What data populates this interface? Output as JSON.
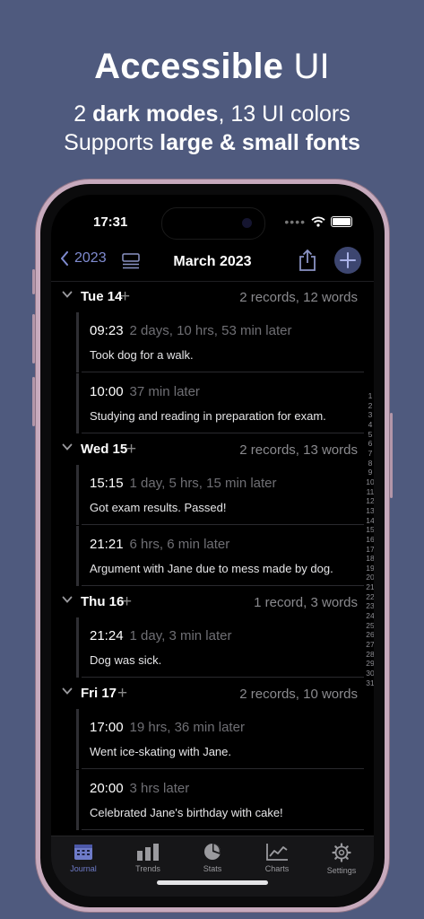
{
  "promo": {
    "title_bold": "Accessible",
    "title_regular": "UI",
    "line1_prefix": "2",
    "line1_bold": "dark modes",
    "line1_suffix": ", 13 UI colors",
    "line2_prefix": "Supports",
    "line2_bold": "large & small fonts"
  },
  "status": {
    "time": "17:31",
    "dots": "••••"
  },
  "nav": {
    "back_label": "2023",
    "title": "March 2023",
    "share_icon": "share-icon",
    "add_icon": "plus-icon"
  },
  "days": [
    {
      "date": "Tue 14",
      "summary": "2 records, 12 words",
      "entries": [
        {
          "time": "09:23",
          "gap": "2 days, 10 hrs, 53 min later",
          "text": "Took dog for a walk."
        },
        {
          "time": "10:00",
          "gap": "37 min later",
          "text": "Studying and reading in preparation for exam."
        }
      ]
    },
    {
      "date": "Wed 15",
      "summary": "2 records, 13 words",
      "entries": [
        {
          "time": "15:15",
          "gap": "1 day, 5 hrs, 15 min later",
          "text": "Got exam results. Passed!"
        },
        {
          "time": "21:21",
          "gap": "6 hrs, 6 min later",
          "text": "Argument with Jane due to mess made by dog."
        }
      ]
    },
    {
      "date": "Thu 16",
      "summary": "1 record, 3 words",
      "entries": [
        {
          "time": "21:24",
          "gap": "1 day, 3 min later",
          "text": "Dog was sick."
        }
      ]
    },
    {
      "date": "Fri 17",
      "summary": "2 records, 10 words",
      "entries": [
        {
          "time": "17:00",
          "gap": "19 hrs, 36 min later",
          "text": "Went ice-skating with Jane."
        },
        {
          "time": "20:00",
          "gap": "3 hrs later",
          "text": "Celebrated Jane's birthday with cake!"
        }
      ]
    }
  ],
  "day_index": [
    "1",
    "2",
    "3",
    "4",
    "5",
    "6",
    "7",
    "8",
    "9",
    "10",
    "11",
    "12",
    "13",
    "14",
    "15",
    "16",
    "17",
    "18",
    "19",
    "20",
    "21",
    "22",
    "23",
    "24",
    "25",
    "26",
    "27",
    "28",
    "29",
    "30",
    "31"
  ],
  "tabs": [
    {
      "label": "Journal",
      "icon": "calendar-icon",
      "active": true
    },
    {
      "label": "Trends",
      "icon": "bar-chart-icon",
      "active": false
    },
    {
      "label": "Stats",
      "icon": "pie-chart-icon",
      "active": false
    },
    {
      "label": "Charts",
      "icon": "line-chart-icon",
      "active": false
    },
    {
      "label": "Settings",
      "icon": "gear-icon",
      "active": false
    }
  ],
  "colors": {
    "background": "#4f5a7e",
    "accent": "#6e7bc8",
    "frame": "#c7aabd"
  }
}
